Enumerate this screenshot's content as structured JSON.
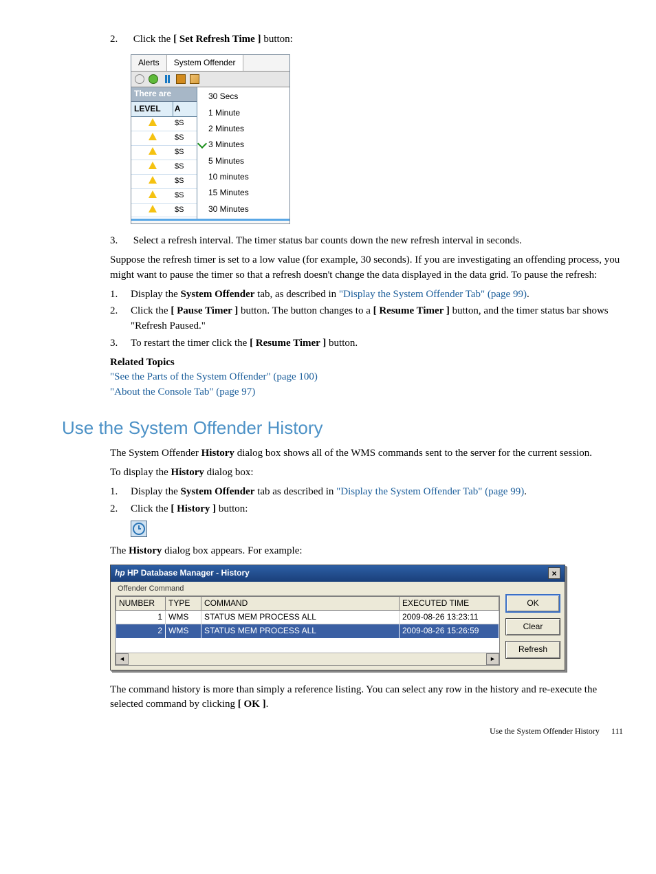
{
  "steps_top": [
    {
      "num": "2.",
      "pre": "Click the ",
      "bold": "[ Set Refresh Time ]",
      "post": " button:"
    }
  ],
  "alerts_window": {
    "tab_alerts": "Alerts",
    "tab_offender": "System Offender",
    "status_bar_prefix": "There are ",
    "header_level": "LEVEL",
    "header_a": "A",
    "rows": [
      {
        "c2": "$S"
      },
      {
        "c2": "$S"
      },
      {
        "c2": "$S"
      },
      {
        "c2": "$S"
      },
      {
        "c2": "$S"
      },
      {
        "c2": "$S"
      },
      {
        "c2": "$S"
      }
    ],
    "right_options": [
      "30 Secs",
      "1 Minute",
      "2 Minutes",
      "3 Minutes",
      "5 Minutes",
      "10 minutes",
      "15 Minutes",
      "30 Minutes"
    ],
    "selected_index": 3
  },
  "step3_line": {
    "num": "3.",
    "text": "Select a refresh interval. The timer status bar counts down the new refresh interval in seconds."
  },
  "suppose_para": "Suppose the refresh timer is set to a low value (for example, 30 seconds). If you are investigating an offending process, you might want to pause the timer so that a refresh doesn't change the data displayed in the data grid. To pause the refresh:",
  "pause_steps": [
    {
      "num": "1.",
      "pre": "Display the ",
      "bold": "System Offender",
      "mid": " tab, as described in ",
      "link": "\"Display the System Offender Tab\" (page 99)",
      "post": "."
    },
    {
      "num": "2.",
      "pre": "Click the ",
      "bold": "[ Pause Timer ]",
      "mid": " button. The button changes to a ",
      "bold2": "[ Resume Timer ]",
      "post": " button, and the timer status bar shows \"Refresh Paused.\""
    },
    {
      "num": "3.",
      "pre": "To restart the timer click the ",
      "bold": "[ Resume Timer ]",
      "post": " button."
    }
  ],
  "related": {
    "heading": "Related Topics",
    "links": [
      "\"See the Parts of the System Offender\" (page 100)",
      "\"About the Console Tab\" (page 97)"
    ]
  },
  "section_title": "Use the System Offender History",
  "history_intro_pre": "The System Offender ",
  "history_intro_bold": "History",
  "history_intro_post": " dialog box shows all of the WMS commands sent to the server for the current session.",
  "history_display_pre": "To display the ",
  "history_display_bold": "History",
  "history_display_post": " dialog box:",
  "display_steps": [
    {
      "num": "1.",
      "pre": "Display the ",
      "bold": "System Offender",
      "mid": " tab as described in ",
      "link": "\"Display the System Offender Tab\" (page 99)",
      "post": "."
    },
    {
      "num": "2.",
      "pre": "Click the ",
      "bold": "[ History ]",
      "post": " button:"
    }
  ],
  "history_appears_pre": "The ",
  "history_appears_bold": "History",
  "history_appears_post": " dialog box appears. For example:",
  "history_dialog": {
    "title_hp": "hp",
    "title_rest": " HP Database Manager - History",
    "fieldset": "Offender Command",
    "headers": {
      "number": "NUMBER",
      "type": "TYPE",
      "command": "COMMAND",
      "time": "EXECUTED TIME"
    },
    "rows": [
      {
        "number": "1",
        "type": "WMS",
        "command": "STATUS MEM PROCESS ALL",
        "time": "2009-08-26 13:23:11",
        "selected": false
      },
      {
        "number": "2",
        "type": "WMS",
        "command": "STATUS MEM PROCESS ALL",
        "time": "2009-08-26 15:26:59",
        "selected": true
      }
    ],
    "buttons": {
      "ok": "OK",
      "clear": "Clear",
      "refresh": "Refresh"
    }
  },
  "closing_pre": "The command history is more than simply a reference listing. You can select any row in the history and re-execute the selected command by clicking ",
  "closing_bold": "[ OK ]",
  "closing_post": ".",
  "footer_text": "Use the System Offender History",
  "footer_page": "111"
}
